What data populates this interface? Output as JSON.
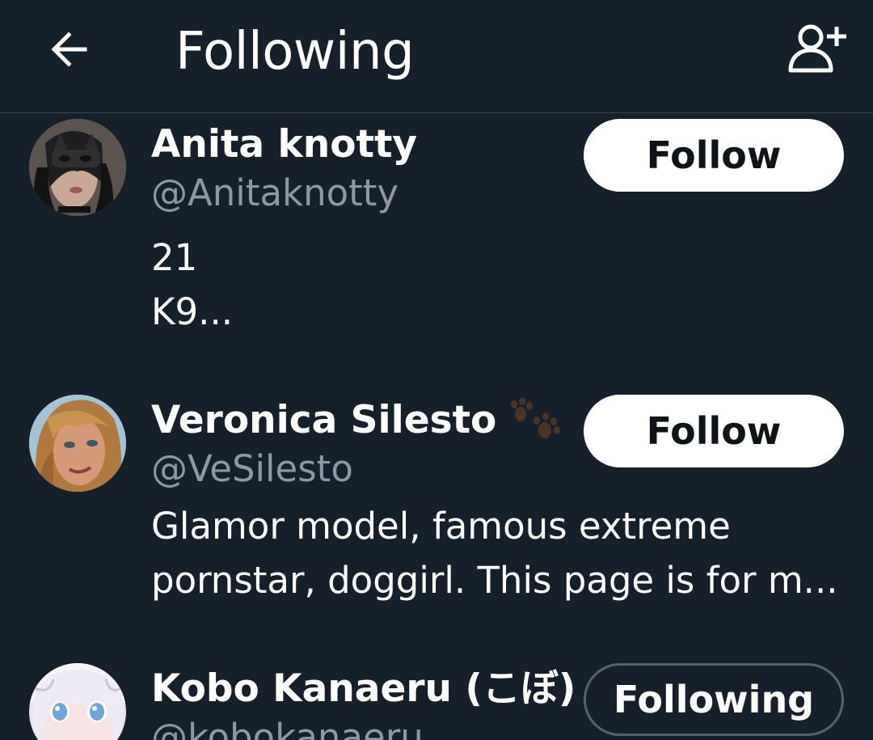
{
  "header": {
    "title": "Following",
    "back_icon": "arrow-left-icon",
    "add_user_icon": "person-add-icon"
  },
  "users": [
    {
      "name": "Anita knotty",
      "handle": "@Anitaknotty",
      "bio_lines": [
        "21",
        "K9..."
      ],
      "button_label": "Follow",
      "following": false
    },
    {
      "name": "Veronica Silesto",
      "emoji": "paw-prints-icon",
      "handle": "@VeSilesto",
      "bio_lines": [
        "Glamor model, famous extreme",
        "pornstar, doggirl. This page is for m..."
      ],
      "button_label": "Follow",
      "following": false
    },
    {
      "name": "Kobo Kanaeru (こぼ)",
      "handle": "@kobokanaeru",
      "bio_lines": [],
      "button_label": "Following",
      "following": true
    }
  ],
  "colors": {
    "background": "#15202b",
    "secondary_text": "#8b98a5",
    "divider": "#38444d",
    "follow_button_bg": "#ffffff",
    "follow_button_text": "#0f1419"
  }
}
